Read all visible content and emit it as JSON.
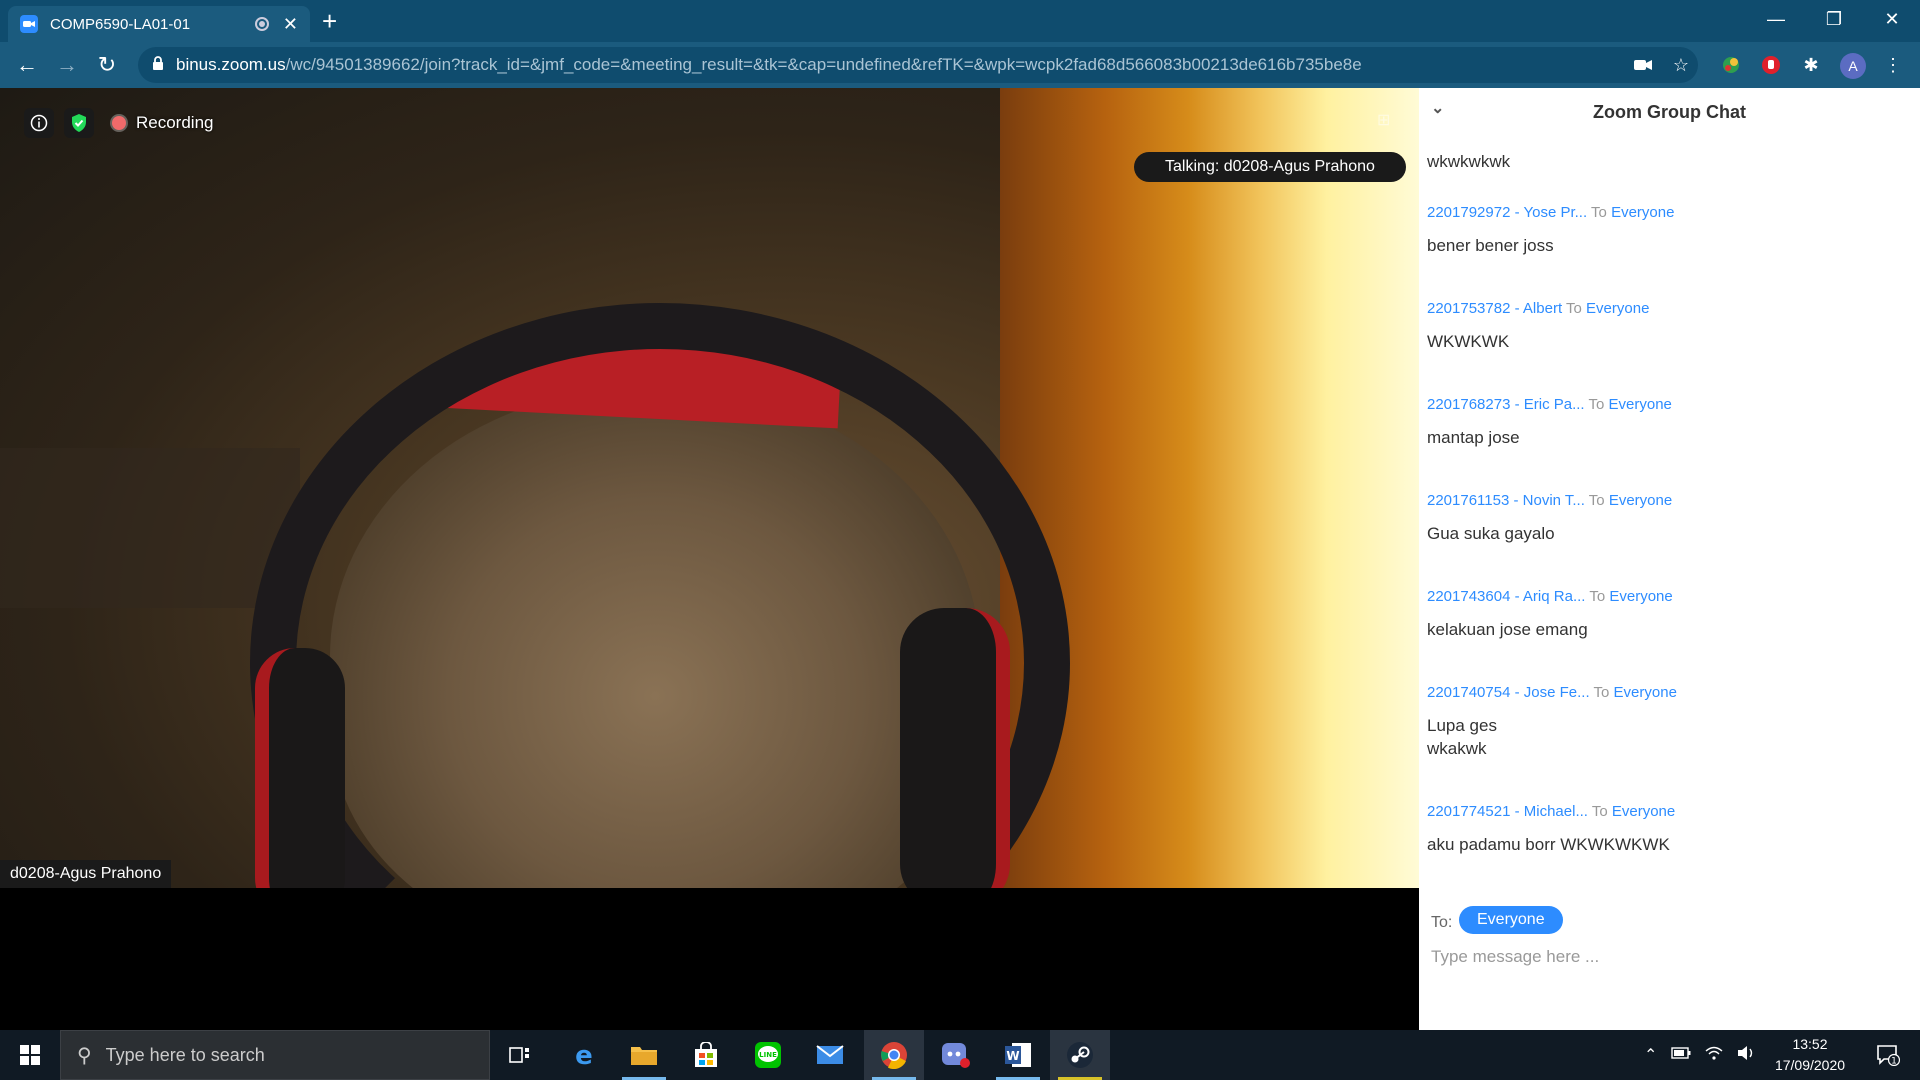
{
  "browser": {
    "tab_title": "COMP6590-LA01-01",
    "url_host": "binus.zoom.us",
    "url_path": "/wc/94501389662/join?track_id=&jmf_code=&meeting_result=&tk=&cap=undefined&refTK=&wpk=wcpk2fad68d566083b00213de616b735be8e",
    "profile_initial": "A"
  },
  "meeting": {
    "recording_label": "Recording",
    "talking_label": "Talking: d0208-Agus Prahono",
    "participant_name": "d0208-Agus Prahono"
  },
  "chat": {
    "title": "Zoom Group Chat",
    "to_label": "To",
    "first_message": "wkwkwkwk",
    "messages": [
      {
        "sender": "2201792972 - Yose Pr...",
        "to": "Everyone",
        "text": "bener bener joss"
      },
      {
        "sender": "2201753782 - Albert",
        "to": "Everyone",
        "text": "WKWKWK"
      },
      {
        "sender": "2201768273 - Eric Pa...",
        "to": "Everyone",
        "text": "mantap jose"
      },
      {
        "sender": "2201761153 - Novin T...",
        "to": "Everyone",
        "text": "Gua suka gayalo"
      },
      {
        "sender": "2201743604 - Ariq Ra...",
        "to": "Everyone",
        "text": "kelakuan jose emang"
      },
      {
        "sender": "2201740754 - Jose Fe...",
        "to": "Everyone",
        "text": "Lupa ges",
        "text2": "wkakwk"
      },
      {
        "sender": "2201774521 - Michael...",
        "to": "Everyone",
        "text": "aku padamu borr WKWKWKWK"
      }
    ],
    "composer_to_label": "To:",
    "composer_recipient": "Everyone",
    "composer_placeholder": "Type message here ..."
  },
  "taskbar": {
    "search_placeholder": "Type here to search",
    "time": "13:52",
    "date": "17/09/2020",
    "notification_count": "1"
  },
  "colors": {
    "accent": "#2d8cff",
    "chrome_dark": "#0f4c6e",
    "chrome_toolbar": "#1b5b7e"
  }
}
